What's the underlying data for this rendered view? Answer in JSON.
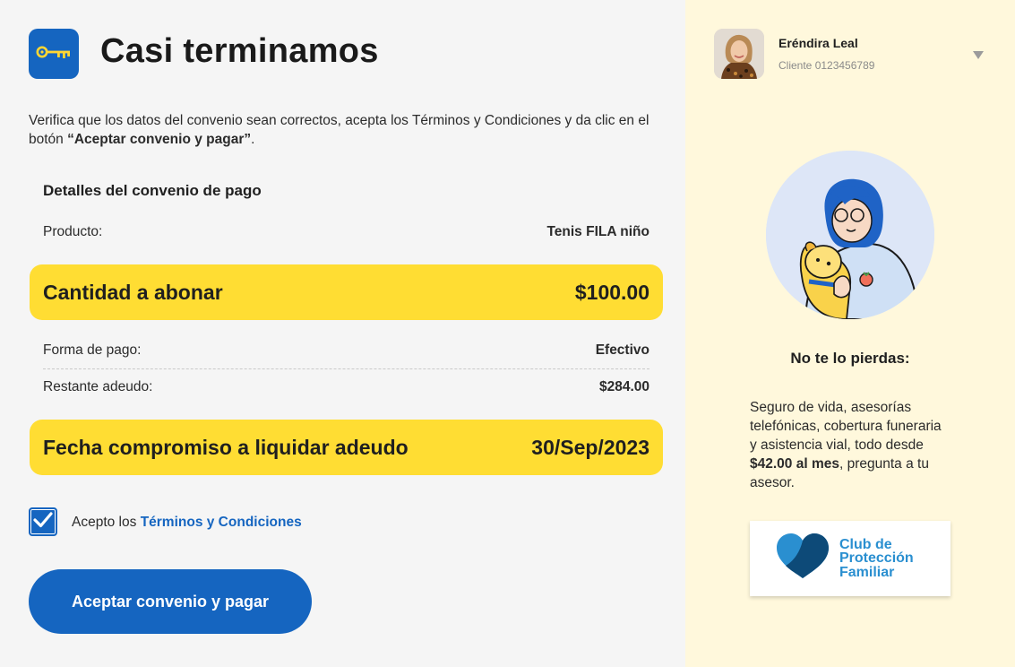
{
  "header": {
    "title": "Casi terminamos",
    "icon": "key-icon"
  },
  "intro": {
    "text_before": "Verifica que los datos del convenio sean correctos, acepta los Términos y Condiciones y da clic en el botón ",
    "emphasis": "“Aceptar convenio y pagar”",
    "text_after": "."
  },
  "details": {
    "section_title": "Detalles del convenio de pago",
    "product_label": "Producto:",
    "product_value": "Tenis FILA niño",
    "amount_label": "Cantidad a abonar",
    "amount_value": "$100.00",
    "payment_form_label": "Forma de pago:",
    "payment_form_value": "Efectivo",
    "remaining_label": "Restante adeudo:",
    "remaining_value": "$284.00",
    "due_date_label": "Fecha compromiso a liquidar adeudo",
    "due_date_value": "30/Sep/2023"
  },
  "terms": {
    "checked": true,
    "prefix": "Acepto los ",
    "link_text": "Términos y Condiciones"
  },
  "cta": {
    "label": "Aceptar convenio y pagar"
  },
  "user": {
    "name": "Eréndira Leal",
    "client_id": "Cliente 0123456789"
  },
  "promo": {
    "title": "No te lo pierdas:",
    "text_before": "Seguro de vida, asesorías telefónicas, cobertura funeraria y asistencia vial, todo desde ",
    "price": "$42.00 al mes",
    "text_after": ", pregunta a tu asesor.",
    "club_line1": "Club de",
    "club_line2": "Protección",
    "club_line3": "Familiar"
  },
  "colors": {
    "primary": "#1565c0",
    "highlight": "#ffdd33",
    "main_bg": "#f5f5f5",
    "side_bg": "#fff8dc",
    "club_blue": "#2a8fd0",
    "club_dark": "#0d4a78"
  }
}
